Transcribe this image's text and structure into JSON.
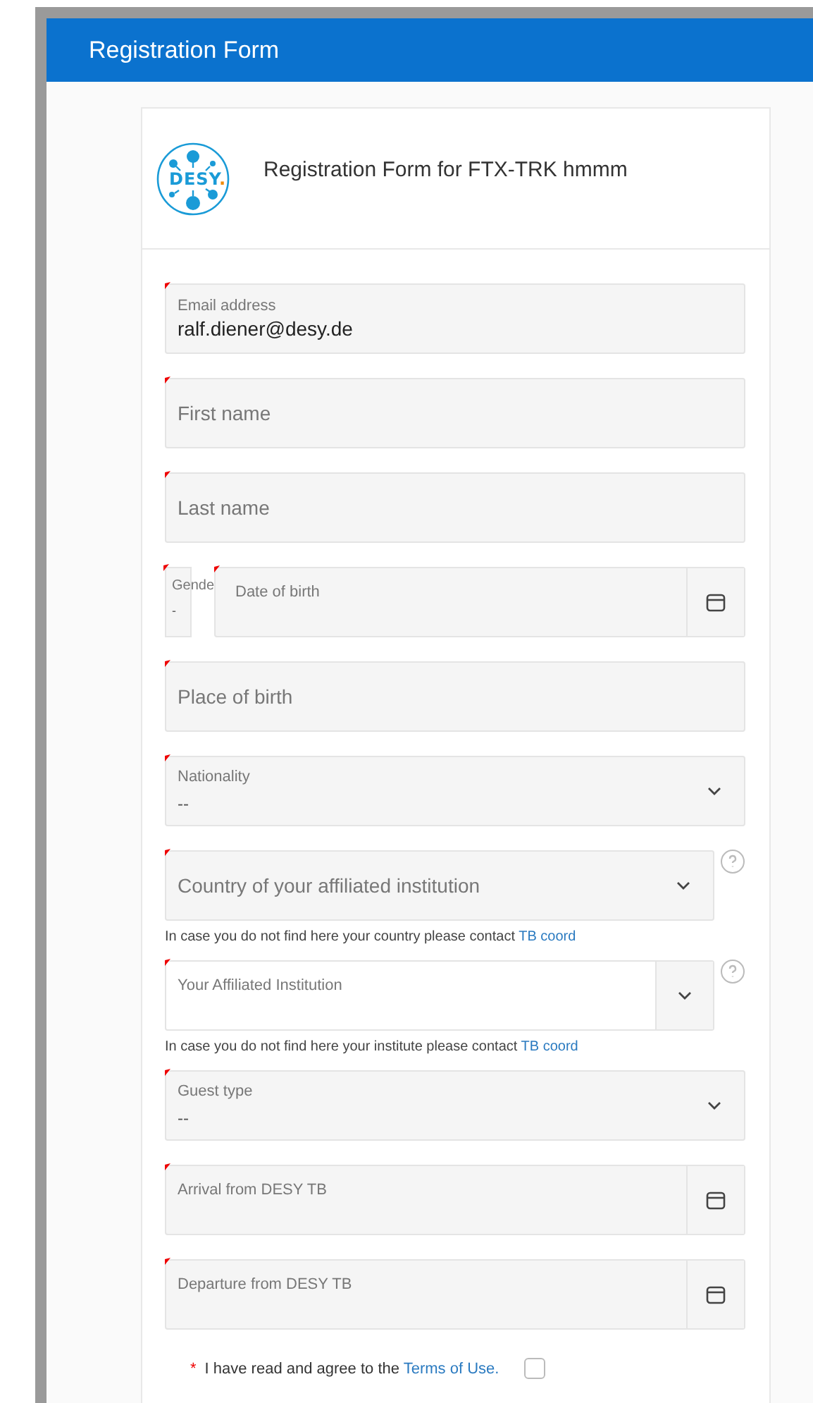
{
  "header": {
    "title": "Registration Form"
  },
  "form": {
    "logo": {
      "text": "DESY",
      "accent": "."
    },
    "title": "Registration Form for FTX-TRK hmmm"
  },
  "fields": [
    {
      "kind": "text",
      "required": true,
      "label": "Email address",
      "value": "ralf.diener@desy.de"
    },
    {
      "kind": "text",
      "required": true,
      "placeholder": "First name"
    },
    {
      "kind": "text",
      "required": true,
      "placeholder": "Last name"
    },
    {
      "kind": "pair",
      "parts": [
        {
          "kind": "select",
          "required": true,
          "label": "Gende",
          "value": "-"
        },
        {
          "kind": "date",
          "required": true,
          "label": "Date of birth"
        }
      ]
    },
    {
      "kind": "text",
      "required": true,
      "placeholder": "Place of birth"
    },
    {
      "kind": "select",
      "required": true,
      "label": "Nationality",
      "value": "--"
    },
    {
      "kind": "select",
      "required": true,
      "placeholder": "Country of your affiliated institution",
      "help": true,
      "hint": {
        "text": "In case you do not find here your country please contact",
        "link": "TB coord"
      }
    },
    {
      "kind": "combo",
      "required": true,
      "label": "Your Affiliated Institution",
      "help": true,
      "hint": {
        "text": "In case you do not find here your institute please contact",
        "link": "TB coord"
      }
    },
    {
      "kind": "select",
      "required": true,
      "label": "Guest type",
      "value": "--"
    },
    {
      "kind": "date",
      "required": true,
      "label": "Arrival from DESY TB"
    },
    {
      "kind": "date",
      "required": true,
      "label": "Departure from DESY TB"
    }
  ],
  "terms": {
    "marker": "*",
    "text": "I have read and agree to the",
    "link": "Terms of Use.",
    "checked": false
  }
}
